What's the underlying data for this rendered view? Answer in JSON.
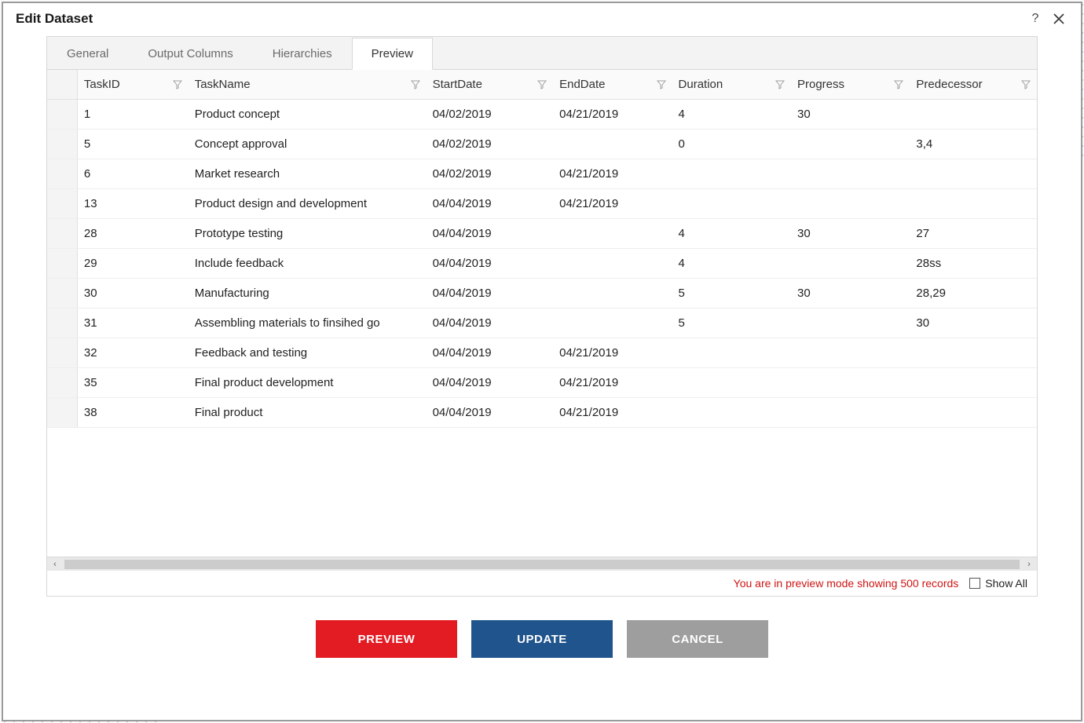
{
  "header": {
    "title": "Edit Dataset"
  },
  "tabs": [
    {
      "label": "General",
      "active": false
    },
    {
      "label": "Output Columns",
      "active": false
    },
    {
      "label": "Hierarchies",
      "active": false
    },
    {
      "label": "Preview",
      "active": true
    }
  ],
  "grid": {
    "columns": [
      {
        "key": "TaskID",
        "label": "TaskID"
      },
      {
        "key": "TaskName",
        "label": "TaskName"
      },
      {
        "key": "StartDate",
        "label": "StartDate"
      },
      {
        "key": "EndDate",
        "label": "EndDate"
      },
      {
        "key": "Duration",
        "label": "Duration"
      },
      {
        "key": "Progress",
        "label": "Progress"
      },
      {
        "key": "Predecessor",
        "label": "Predecessor"
      }
    ],
    "rows": [
      {
        "TaskID": "1",
        "TaskName": "Product concept",
        "StartDate": "04/02/2019",
        "EndDate": "04/21/2019",
        "Duration": "4",
        "Progress": "30",
        "Predecessor": ""
      },
      {
        "TaskID": "5",
        "TaskName": "Concept approval",
        "StartDate": "04/02/2019",
        "EndDate": "",
        "Duration": "0",
        "Progress": "",
        "Predecessor": "3,4"
      },
      {
        "TaskID": "6",
        "TaskName": "Market research",
        "StartDate": "04/02/2019",
        "EndDate": "04/21/2019",
        "Duration": "",
        "Progress": "",
        "Predecessor": ""
      },
      {
        "TaskID": "13",
        "TaskName": "Product design and development",
        "StartDate": "04/04/2019",
        "EndDate": "04/21/2019",
        "Duration": "",
        "Progress": "",
        "Predecessor": ""
      },
      {
        "TaskID": "28",
        "TaskName": "Prototype testing",
        "StartDate": "04/04/2019",
        "EndDate": "",
        "Duration": "4",
        "Progress": "30",
        "Predecessor": "27"
      },
      {
        "TaskID": "29",
        "TaskName": "Include feedback",
        "StartDate": "04/04/2019",
        "EndDate": "",
        "Duration": "4",
        "Progress": "",
        "Predecessor": "28ss"
      },
      {
        "TaskID": "30",
        "TaskName": "Manufacturing",
        "StartDate": "04/04/2019",
        "EndDate": "",
        "Duration": "5",
        "Progress": "30",
        "Predecessor": "28,29"
      },
      {
        "TaskID": "31",
        "TaskName": "Assembling materials to finsihed go",
        "StartDate": "04/04/2019",
        "EndDate": "",
        "Duration": "5",
        "Progress": "",
        "Predecessor": "30"
      },
      {
        "TaskID": "32",
        "TaskName": "Feedback and testing",
        "StartDate": "04/04/2019",
        "EndDate": "04/21/2019",
        "Duration": "",
        "Progress": "",
        "Predecessor": ""
      },
      {
        "TaskID": "35",
        "TaskName": "Final product development",
        "StartDate": "04/04/2019",
        "EndDate": "04/21/2019",
        "Duration": "",
        "Progress": "",
        "Predecessor": ""
      },
      {
        "TaskID": "38",
        "TaskName": "Final product",
        "StartDate": "04/04/2019",
        "EndDate": "04/21/2019",
        "Duration": "",
        "Progress": "",
        "Predecessor": ""
      }
    ]
  },
  "footer": {
    "preview_message": "You are in preview mode showing 500 records",
    "show_all_label": "Show All",
    "show_all_checked": false
  },
  "buttons": {
    "preview": "PREVIEW",
    "update": "UPDATE",
    "cancel": "CANCEL"
  }
}
